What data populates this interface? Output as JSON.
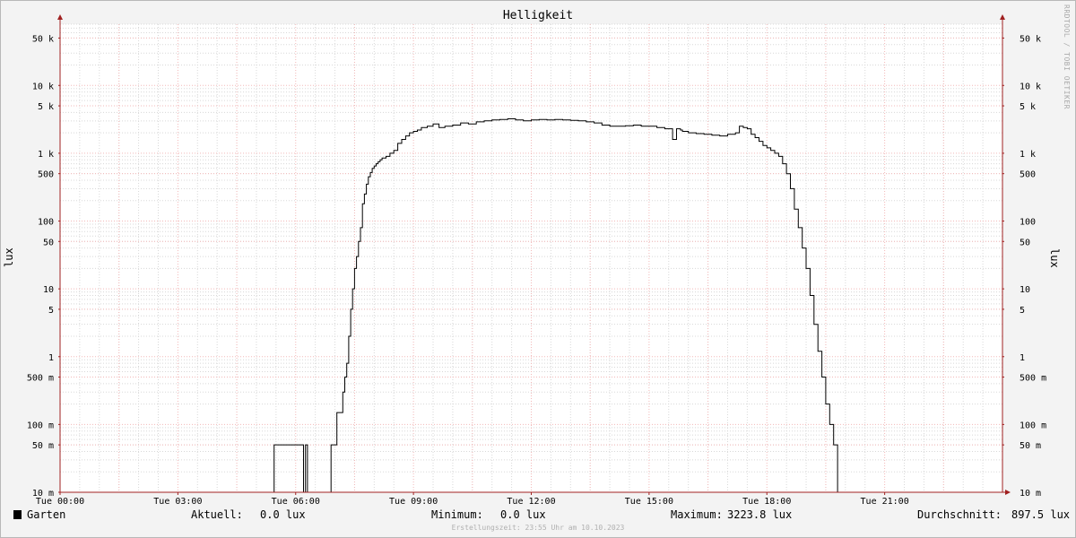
{
  "chart_data": {
    "type": "line",
    "title": "Helligkeit",
    "ylabel": "lux",
    "yscale": "log",
    "ylim": [
      0.01,
      80000
    ],
    "xlim_hours": [
      0,
      24
    ],
    "x_ticks": [
      {
        "label": "Tue 00:00",
        "hour": 0
      },
      {
        "label": "Tue 03:00",
        "hour": 3
      },
      {
        "label": "Tue 06:00",
        "hour": 6
      },
      {
        "label": "Tue 09:00",
        "hour": 9
      },
      {
        "label": "Tue 12:00",
        "hour": 12
      },
      {
        "label": "Tue 15:00",
        "hour": 15
      },
      {
        "label": "Tue 18:00",
        "hour": 18
      },
      {
        "label": "Tue 21:00",
        "hour": 21
      }
    ],
    "y_ticks": [
      {
        "label": "50 k",
        "value": 50000
      },
      {
        "label": "10 k",
        "value": 10000
      },
      {
        "label": "5 k",
        "value": 5000
      },
      {
        "label": "1 k",
        "value": 1000
      },
      {
        "label": "500",
        "value": 500
      },
      {
        "label": "100",
        "value": 100
      },
      {
        "label": "50",
        "value": 50
      },
      {
        "label": "10",
        "value": 10
      },
      {
        "label": "5",
        "value": 5
      },
      {
        "label": "1",
        "value": 1
      },
      {
        "label": "500 m",
        "value": 0.5
      },
      {
        "label": "100 m",
        "value": 0.1
      },
      {
        "label": "50 m",
        "value": 0.05
      },
      {
        "label": "10 m",
        "value": 0.01
      }
    ],
    "grid": true,
    "series": [
      {
        "name": "Garten",
        "color": "#000000",
        "hours": [
          0,
          5.45,
          5.45,
          6.2,
          6.2,
          6.25,
          6.25,
          6.3,
          6.3,
          6.35,
          6.35,
          6.9,
          6.9,
          7.05,
          7.05,
          7.2,
          7.25,
          7.3,
          7.35,
          7.4,
          7.45,
          7.5,
          7.55,
          7.6,
          7.65,
          7.7,
          7.75,
          7.8,
          7.85,
          7.9,
          7.95,
          8.0,
          8.05,
          8.1,
          8.15,
          8.2,
          8.3,
          8.4,
          8.5,
          8.6,
          8.7,
          8.8,
          8.9,
          9.0,
          9.1,
          9.2,
          9.35,
          9.5,
          9.65,
          9.8,
          10.0,
          10.2,
          10.4,
          10.6,
          10.8,
          11.0,
          11.2,
          11.4,
          11.6,
          11.8,
          12.0,
          12.2,
          12.4,
          12.6,
          12.8,
          13.0,
          13.2,
          13.4,
          13.6,
          13.8,
          14.0,
          14.2,
          14.4,
          14.6,
          14.8,
          15.0,
          15.2,
          15.4,
          15.6,
          15.7,
          15.8,
          15.85,
          15.9,
          16.0,
          16.2,
          16.4,
          16.6,
          16.8,
          17.0,
          17.2,
          17.3,
          17.4,
          17.5,
          17.6,
          17.7,
          17.8,
          17.9,
          18.0,
          18.1,
          18.2,
          18.3,
          18.4,
          18.5,
          18.6,
          18.7,
          18.8,
          18.9,
          19.0,
          19.1,
          19.2,
          19.3,
          19.4,
          19.5,
          19.6,
          19.7,
          19.8,
          19.9,
          19.95,
          20.05,
          24
        ],
        "values": [
          0.01,
          0.01,
          0.05,
          0.05,
          0.01,
          0.01,
          0.05,
          0.05,
          0.01,
          0.01,
          0.01,
          0.01,
          0.05,
          0.05,
          0.15,
          0.3,
          0.5,
          0.8,
          2,
          5,
          10,
          20,
          30,
          50,
          80,
          180,
          250,
          350,
          450,
          520,
          600,
          650,
          700,
          750,
          800,
          850,
          900,
          1000,
          1100,
          1400,
          1600,
          1800,
          2000,
          2100,
          2200,
          2400,
          2500,
          2700,
          2400,
          2500,
          2600,
          2800,
          2700,
          2900,
          3000,
          3100,
          3150,
          3223.8,
          3100,
          3000,
          3100,
          3150,
          3100,
          3150,
          3100,
          3050,
          3000,
          2900,
          2800,
          2600,
          2500,
          2500,
          2550,
          2600,
          2500,
          2500,
          2400,
          2300,
          1600,
          2300,
          2200,
          2100,
          2100,
          2000,
          1950,
          1900,
          1850,
          1800,
          1900,
          2000,
          2500,
          2400,
          2300,
          1900,
          1700,
          1500,
          1300,
          1200,
          1100,
          1000,
          900,
          700,
          500,
          300,
          150,
          80,
          40,
          20,
          8,
          3,
          1.2,
          0.5,
          0.2,
          0.1,
          0.05,
          0.01,
          0.01
        ],
        "line_width": 1
      }
    ],
    "legend": {
      "placement": "bottom",
      "entries": [
        {
          "name": "Garten",
          "color": "#000000"
        }
      ]
    }
  },
  "stats": {
    "current": {
      "label": "Aktuell:",
      "value": "0.0 lux"
    },
    "minimum": {
      "label": "Minimum:",
      "value": "0.0 lux"
    },
    "maximum": {
      "label": "Maximum:",
      "value": "3223.8 lux"
    },
    "average": {
      "label": "Durchschnitt:",
      "value": "897.5 lux"
    }
  },
  "watermark": "RRDTOOL / TOBI OETIKER",
  "footer": "Erstellungszeit: 23:55 Uhr am 10.10.2023",
  "colors": {
    "background": "#f3f3f3",
    "plot_background": "#ffffff",
    "major_grid": "#f2b8b8",
    "minor_grid": "#d8d8d8",
    "axis": "#a02020",
    "line": "#000000"
  }
}
